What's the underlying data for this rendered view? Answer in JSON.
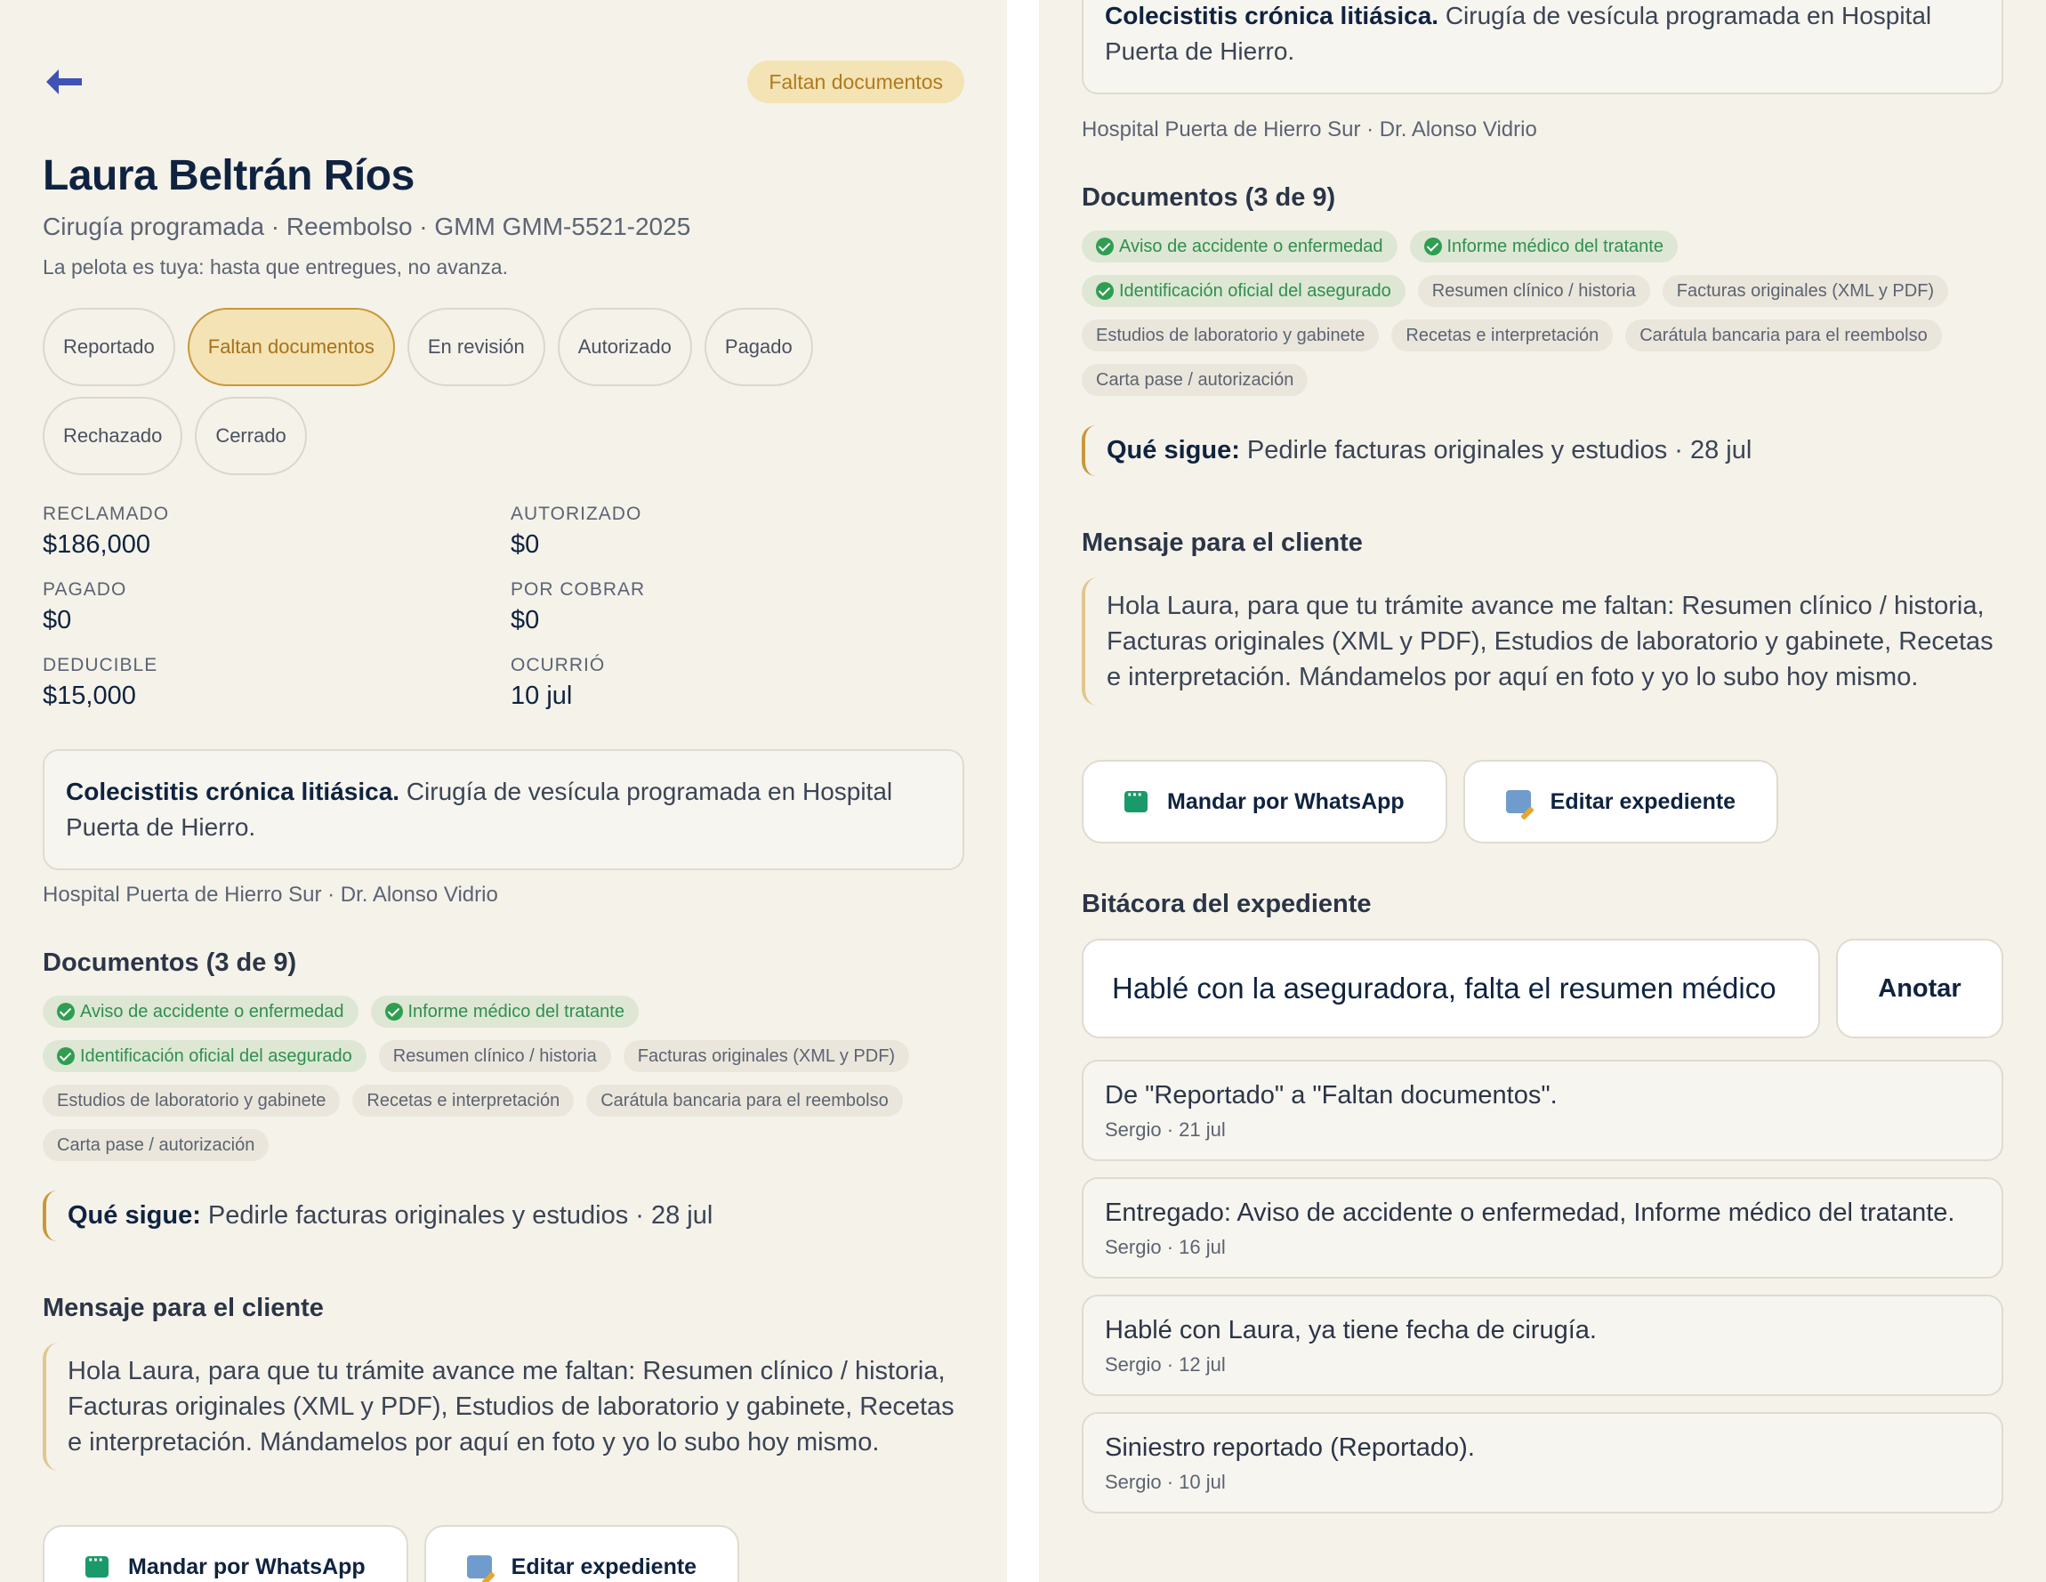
{
  "header": {
    "status": "Faltan documentos"
  },
  "patient": {
    "name": "Laura Beltrán Ríos",
    "subtitle": "Cirugía programada · Reembolso · GMM GMM-5521-2025",
    "note": "La pelota es tuya: hasta que entregues, no avanza."
  },
  "states": [
    "Reportado",
    "Faltan documentos",
    "En revisión",
    "Autorizado",
    "Pagado",
    "Rechazado",
    "Cerrado"
  ],
  "active_state": "Faltan documentos",
  "amounts": {
    "reclamado": {
      "label": "Reclamado",
      "value": "$186,000"
    },
    "autorizado": {
      "label": "Autorizado",
      "value": "$0"
    },
    "pagado": {
      "label": "Pagado",
      "value": "$0"
    },
    "por_cobrar": {
      "label": "Por cobrar",
      "value": "$0"
    },
    "deducible": {
      "label": "Deducible",
      "value": "$15,000"
    },
    "ocurrio": {
      "label": "Ocurrió",
      "value": "10 jul"
    }
  },
  "diagnosis": {
    "title": "Colecistitis crónica litiásica.",
    "text": " Cirugía de vesícula programada en Hospital Puerta de Hierro."
  },
  "hospital": "Hospital Puerta de Hierro Sur · Dr. Alonso Vidrio",
  "documents": {
    "title": "Documentos (3 de 9)",
    "items": [
      {
        "label": "Aviso de accidente o enfermedad",
        "done": true
      },
      {
        "label": "Informe médico del tratante",
        "done": true
      },
      {
        "label": "Identificación oficial del asegurado",
        "done": true
      },
      {
        "label": "Resumen clínico / historia",
        "done": false
      },
      {
        "label": "Facturas originales (XML y PDF)",
        "done": false
      },
      {
        "label": "Estudios de laboratorio y gabinete",
        "done": false
      },
      {
        "label": "Recetas e interpretación",
        "done": false
      },
      {
        "label": "Carátula bancaria para el reembolso",
        "done": false
      },
      {
        "label": "Carta pase / autorización",
        "done": false
      }
    ]
  },
  "next_step": {
    "label": "Qué sigue:",
    "text": " Pedirle facturas originales y estudios · 28 jul"
  },
  "client_message": {
    "title": "Mensaje para el cliente",
    "text": "Hola Laura, para que tu trámite avance me faltan: Resumen clínico / historia, Facturas originales (XML y PDF), Estudios de laboratorio y gabinete, Recetas e interpretación. Mándamelos por aquí en foto y yo lo subo hoy mismo."
  },
  "actions": {
    "whatsapp": "Mandar por WhatsApp",
    "edit": "Editar expediente"
  },
  "log": {
    "title": "Bitácora del expediente",
    "input_value": "Hablé con la aseguradora, falta el resumen médico",
    "submit": "Anotar",
    "entries": [
      {
        "text": "De \"Reportado\" a \"Faltan documentos\".",
        "meta": "Sergio · 21 jul"
      },
      {
        "text": "Entregado: Aviso de accidente o enfermedad, Informe médico del tratante.",
        "meta": "Sergio · 16 jul"
      },
      {
        "text": "Hablé con Laura, ya tiene fecha de cirugía.",
        "meta": "Sergio · 12 jul"
      },
      {
        "text": "Siniestro reportado (Reportado).",
        "meta": "Sergio · 10 jul"
      }
    ]
  },
  "colors": {
    "page_bg": "#f5f2ea",
    "title": "#0f2340",
    "pending_accent": "#c8983a",
    "pending_bg": "#f3e3b5",
    "done_green": "#2f9e50",
    "back_arrow": "#3f53b5",
    "whatsapp": "#1a9a6a"
  },
  "icons": [
    "back-arrow-icon",
    "check-icon",
    "whatsapp-chat-icon",
    "edit-document-icon"
  ]
}
